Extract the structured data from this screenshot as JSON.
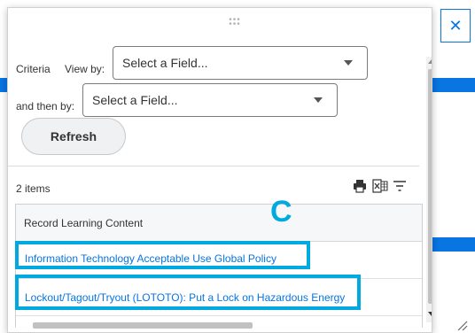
{
  "close": {
    "icon": "close-icon",
    "glyph": "✕"
  },
  "criteria": {
    "label": "Criteria",
    "view_by_label": "View by:",
    "view_by_value": "Select a Field...",
    "then_by_label": "and then by:",
    "then_by_value": "Select a Field...",
    "refresh_label": "Refresh"
  },
  "results": {
    "count": "2 items",
    "icons": [
      "print-icon",
      "excel-export-icon",
      "filter-icon"
    ],
    "column_header": "Record Learning Content",
    "rows": [
      {
        "title": "Information Technology Acceptable Use Global Policy"
      },
      {
        "title": "Lockout/Tagout/Tryout (LOTOTO): Put a Lock on Hazardous Energy"
      }
    ]
  },
  "annotation": {
    "letter": "C",
    "color": "#00a9e0"
  },
  "colors": {
    "accent": "#0875e1",
    "highlight": "#00a9e0"
  }
}
